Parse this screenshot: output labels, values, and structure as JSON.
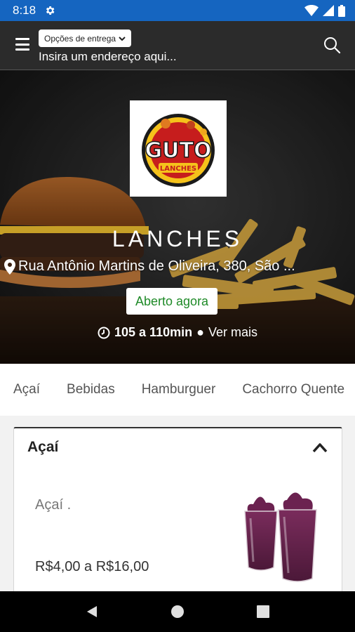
{
  "status_bar": {
    "time": "8:18"
  },
  "header": {
    "delivery_options_label": "Opções de entrega",
    "address_placeholder": "Insira um endereço aqui..."
  },
  "logo": {
    "text_main": "GUTO",
    "text_sub": "LANCHES"
  },
  "store": {
    "name": "LANCHES",
    "address": "Rua Antônio Martins de Oliveira, 380, São ...",
    "status": "Aberto agora",
    "eta": "105 a 110min",
    "see_more": "Ver mais"
  },
  "category_tabs": [
    {
      "label": "Açaí"
    },
    {
      "label": "Bebidas"
    },
    {
      "label": "Hamburguer"
    },
    {
      "label": "Cachorro Quente"
    }
  ],
  "section": {
    "title": "Açaí",
    "items": [
      {
        "name": "Açaí .",
        "price": "R$4,00 a R$16,00"
      }
    ]
  },
  "colors": {
    "status_bar": "#1565c0",
    "header_bg": "#2b2b2b",
    "open_green": "#1e8a27"
  }
}
